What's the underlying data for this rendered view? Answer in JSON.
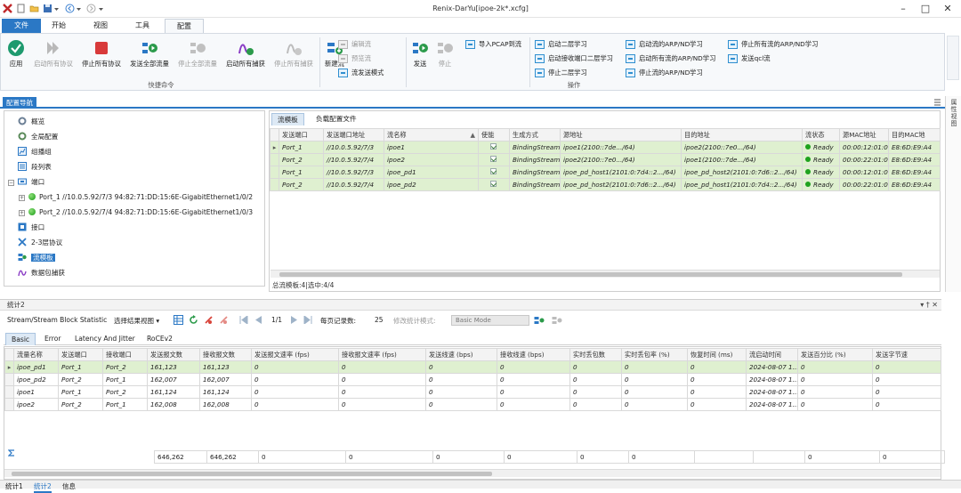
{
  "window": {
    "title": "Renix-DarYu[ipoe-2k*.xcfg]"
  },
  "menu_tabs": [
    "文件",
    "开始",
    "视图",
    "工具",
    "配置"
  ],
  "ribbon": {
    "quick_cmds": {
      "label": "快捷命令",
      "buttons": [
        "应用",
        "启动所有协议",
        "停止所有协议",
        "发送全部流量",
        "停止全部流量",
        "启动所有捕获",
        "停止所有捕获"
      ]
    },
    "new_stream": "新建流",
    "edit_stream": "编辑流",
    "preview_stream": "预览流",
    "stream_send_mode": "流发送模式",
    "send": "发送",
    "stop": "停止",
    "ops": {
      "label": "操作",
      "items": [
        "导入PCAP到流",
        "启动二层学习",
        "启动接收端口二层学习",
        "停止二层学习",
        "启动流的ARP/ND学习",
        "启动所有流的ARP/ND学习",
        "停止流的ARP/ND学习",
        "停止所有流的ARP/ND学习",
        "发送qcl流"
      ]
    }
  },
  "nav": {
    "tab_label": "配置导航",
    "right_panel_label": "属性视图",
    "tree": {
      "overview": "概览",
      "global": "全局配置",
      "modifier_group": "组播组",
      "segment_table": "段列表",
      "ports": "端口",
      "port1": "Port_1 //10.0.5.92/7/3 94:82:71:DD:15:6E-GigabitEthernet1/0/2",
      "port2": "Port_2 //10.0.5.92/7/4 94:82:71:DD:15:6E-GigabitEthernet1/0/3",
      "interface": "接口",
      "protocol": "2-3层协议",
      "stream_template": "流模板",
      "capture": "数据包捕获"
    }
  },
  "flow_panel": {
    "tabs": [
      "流模板",
      "负载配置文件"
    ],
    "columns": [
      "发送端口",
      "发送端口地址",
      "流名称",
      "使能",
      "生成方式",
      "源地址",
      "目的地址",
      "流状态",
      "源MAC地址",
      "目的MAC地"
    ],
    "rows": [
      {
        "port": "Port_1",
        "addr": "//10.0.5.92/7/3",
        "name": "ipoe1",
        "gen": "BindingStream",
        "src": "ipoe1(2100::7de.../64)",
        "dst": "ipoe2(2100::7e0.../64)",
        "state": "Ready",
        "smac": "00:00:12:01:01:03",
        "dmac": "E8:6D:E9:A4"
      },
      {
        "port": "Port_2",
        "addr": "//10.0.5.92/7/4",
        "name": "ipoe2",
        "gen": "BindingStream",
        "src": "ipoe2(2100::7e0.../64)",
        "dst": "ipoe1(2100::7de.../64)",
        "state": "Ready",
        "smac": "00:00:22:01:01:03",
        "dmac": "E8:6D:E9:A4"
      },
      {
        "port": "Port_1",
        "addr": "//10.0.5.92/7/3",
        "name": "ipoe_pd1",
        "gen": "BindingStream",
        "src": "ipoe_pd_host1(2101:0:7d4::2.../64)",
        "dst": "ipoe_pd_host2(2101:0:7d6::2.../64)",
        "state": "Ready",
        "smac": "00:00:12:01:01:03",
        "dmac": "E8:6D:E9:A4"
      },
      {
        "port": "Port_2",
        "addr": "//10.0.5.92/7/4",
        "name": "ipoe_pd2",
        "gen": "BindingStream",
        "src": "ipoe_pd_host2(2101:0:7d6::2.../64)",
        "dst": "ipoe_pd_host1(2101:0:7d4::2.../64)",
        "state": "Ready",
        "smac": "00:00:22:01:01:03",
        "dmac": "E8:6D:E9:A4"
      }
    ],
    "status": "总流模板:4|选中:4/4"
  },
  "stats": {
    "panel_title": "统计2",
    "view_name": "Stream/Stream Block Statistic",
    "select_view": "选择结果视图",
    "page": "1/1",
    "per_page_label": "每页记录数:",
    "per_page": "25",
    "mode_label": "修改统计模式:",
    "mode_value": "Basic Mode",
    "tabs": [
      "Basic",
      "Error",
      "Latency And Jitter",
      "RoCEv2"
    ],
    "columns": [
      "流量名称",
      "发送端口",
      "接收端口",
      "发送报文数",
      "接收报文数",
      "发送报文速率 (fps)",
      "接收报文速率 (fps)",
      "发送线速 (bps)",
      "接收线速 (bps)",
      "实时丢包数",
      "实时丢包率 (%)",
      "恢复时间 (ms)",
      "流启动时间",
      "发送百分比 (%)",
      "发送字节速"
    ],
    "rows": [
      [
        "ipoe_pd1",
        "Port_1",
        "Port_2",
        "161,123",
        "161,123",
        "0",
        "0",
        "0",
        "0",
        "0",
        "0",
        "0",
        "2024-08-07 1...",
        "0",
        "0"
      ],
      [
        "ipoe_pd2",
        "Port_2",
        "Port_1",
        "162,007",
        "162,007",
        "0",
        "0",
        "0",
        "0",
        "0",
        "0",
        "0",
        "2024-08-07 1...",
        "0",
        "0"
      ],
      [
        "ipoe1",
        "Port_1",
        "Port_2",
        "161,124",
        "161,124",
        "0",
        "0",
        "0",
        "0",
        "0",
        "0",
        "0",
        "2024-08-07 1...",
        "0",
        "0"
      ],
      [
        "ipoe2",
        "Port_2",
        "Port_1",
        "162,008",
        "162,008",
        "0",
        "0",
        "0",
        "0",
        "0",
        "0",
        "0",
        "2024-08-07 1...",
        "0",
        "0"
      ]
    ],
    "sum": [
      "646,262",
      "646,262",
      "0",
      "0",
      "0",
      "0",
      "0",
      "0",
      "0",
      "0"
    ]
  },
  "bottom_tabs": [
    "统计1",
    "统计2",
    "信息"
  ],
  "colors": {
    "accent": "#2b78c5",
    "selected_row": "#dff0d0",
    "ready_green": "#1ea21e"
  }
}
